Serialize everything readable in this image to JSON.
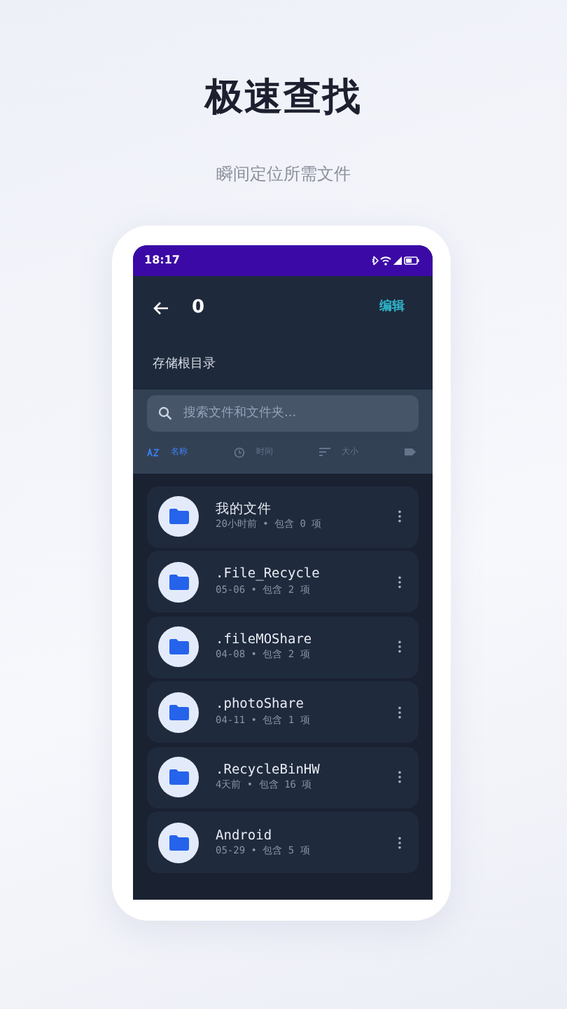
{
  "headline": "极速查找",
  "subtitle": "瞬间定位所需文件",
  "status_bar": {
    "time": "18:17"
  },
  "header": {
    "title": "0",
    "action": "编辑"
  },
  "path": "存储根目录",
  "search": {
    "placeholder": "搜索文件和文件夹..."
  },
  "sort_tabs": [
    {
      "kind": "name",
      "label": "名称",
      "selected": true
    },
    {
      "kind": "time",
      "label": "时间",
      "selected": false
    },
    {
      "kind": "size",
      "label": "大小",
      "selected": false
    },
    {
      "kind": "type",
      "selected": false
    }
  ],
  "folders": [
    {
      "name": "我的文件",
      "meta": "20小时前 • 包含 0 项"
    },
    {
      "name": ".File_Recycle",
      "meta": "05-06 • 包含 2 项"
    },
    {
      "name": ".fileMOShare",
      "meta": "04-08 • 包含 2 项"
    },
    {
      "name": ".photoShare",
      "meta": "04-11 • 包含 1 项"
    },
    {
      "name": ".RecycleBinHW",
      "meta": "4天前 • 包含 16 项"
    },
    {
      "name": "Android",
      "meta": "05-29 • 包含 5 项"
    }
  ]
}
